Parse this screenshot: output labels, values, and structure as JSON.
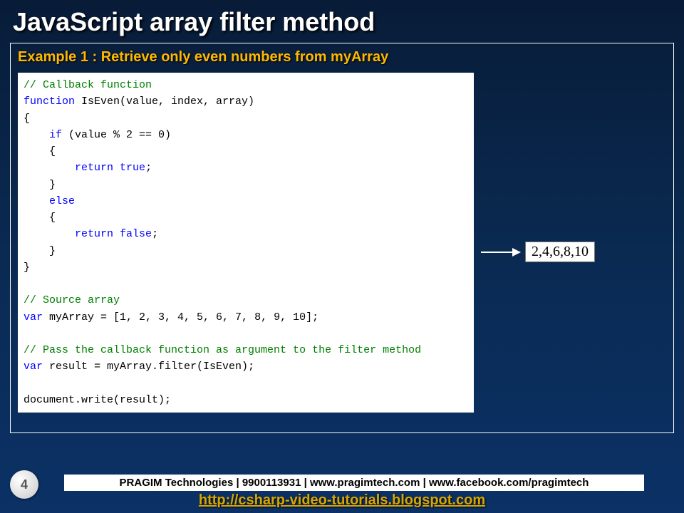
{
  "title": "JavaScript array filter method",
  "example_title": "Example 1 : Retrieve only even numbers from myArray",
  "code": {
    "lines": [
      {
        "t": "cm",
        "s": "// Callback function"
      },
      {
        "t": "mix",
        "s": [
          [
            "kw",
            "function"
          ],
          [
            "",
            " IsEven(value, index, array)"
          ]
        ]
      },
      {
        "t": "",
        "s": "{"
      },
      {
        "t": "mix",
        "s": [
          [
            "",
            "    "
          ],
          [
            "kw",
            "if"
          ],
          [
            "",
            " (value % 2 == 0)"
          ]
        ]
      },
      {
        "t": "",
        "s": "    {"
      },
      {
        "t": "mix",
        "s": [
          [
            "",
            "        "
          ],
          [
            "kw",
            "return"
          ],
          [
            "",
            " "
          ],
          [
            "kw",
            "true"
          ],
          [
            "",
            ";"
          ]
        ]
      },
      {
        "t": "",
        "s": "    }"
      },
      {
        "t": "mix",
        "s": [
          [
            "",
            "    "
          ],
          [
            "kw",
            "else"
          ]
        ]
      },
      {
        "t": "",
        "s": "    {"
      },
      {
        "t": "mix",
        "s": [
          [
            "",
            "        "
          ],
          [
            "kw",
            "return"
          ],
          [
            "",
            " "
          ],
          [
            "kw",
            "false"
          ],
          [
            "",
            ";"
          ]
        ]
      },
      {
        "t": "",
        "s": "    }"
      },
      {
        "t": "",
        "s": "}"
      },
      {
        "t": "",
        "s": ""
      },
      {
        "t": "cm",
        "s": "// Source array"
      },
      {
        "t": "mix",
        "s": [
          [
            "kw",
            "var"
          ],
          [
            "",
            " myArray = [1, 2, 3, 4, 5, 6, 7, 8, 9, 10];"
          ]
        ]
      },
      {
        "t": "",
        "s": ""
      },
      {
        "t": "cm",
        "s": "// Pass the callback function as argument to the filter method"
      },
      {
        "t": "mix",
        "s": [
          [
            "kw",
            "var"
          ],
          [
            "",
            " result = myArray.filter(IsEven);"
          ]
        ]
      },
      {
        "t": "",
        "s": ""
      },
      {
        "t": "",
        "s": "document.write(result);"
      }
    ]
  },
  "output": "2,4,6,8,10",
  "footer_bar": "PRAGIM Technologies | 9900113931 | www.pragimtech.com | www.facebook.com/pragimtech",
  "footer_link": "http://csharp-video-tutorials.blogspot.com",
  "page_number": "4"
}
